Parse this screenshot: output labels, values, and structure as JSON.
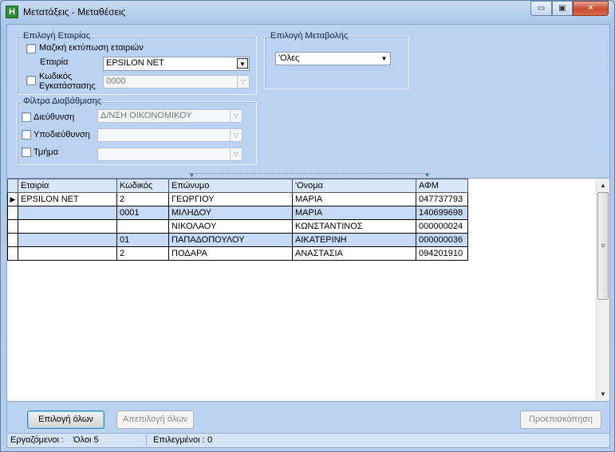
{
  "window": {
    "title": "Μετατάξεις - Μεταθέσεις",
    "app_icon_glyph": "H",
    "minimize_glyph": "▭",
    "maximize_glyph": "▣",
    "close_glyph": "✕"
  },
  "company_group": {
    "legend": "Επιλογή Εταιρίας",
    "mass_print_label": "Μαζική εκτύπωση εταιριών",
    "company_label": "Εταιρία",
    "company_value": "EPSILON NET",
    "install_code_label_1": "Κωδικός",
    "install_code_label_2": "Εγκατάστασης",
    "install_code_value": "0000"
  },
  "change_group": {
    "legend": "Επιλογή Μεταβολής",
    "value": "'Ολες"
  },
  "filter_group": {
    "legend": "Φίλτρα Διαβάθμισης",
    "direction_label": "Διεύθυνση",
    "direction_value": "Δ/ΝΣΗ ΟΙΚΟΝΟΜΙΚΟΥ",
    "subdirection_label": "Υποδιεύθυνση",
    "subdirection_value": "",
    "department_label": "Τμήμα",
    "department_value": ""
  },
  "grid": {
    "columns": [
      "Εταιρία",
      "Κωδικός",
      "Επώνυμο",
      "'Ονομα",
      "ΑΦΜ"
    ],
    "current_row_marker": "▶",
    "rows": [
      {
        "company": "EPSILON NET",
        "code": "2",
        "surname": "ΓΕΩΡΓΙΟΥ",
        "name": "ΜΑΡΙΑ",
        "afm": "047737793"
      },
      {
        "company": "",
        "code": "0001",
        "surname": "ΜΙΛΗΔΟΥ",
        "name": "ΜΑΡΙΑ",
        "afm": "140699698"
      },
      {
        "company": "",
        "code": "",
        "surname": "ΝΙΚΟΛΑΟΥ",
        "name": "ΚΩΝΣΤΑΝΤΙΝΟΣ",
        "afm": "000000024"
      },
      {
        "company": "",
        "code": "01",
        "surname": "ΠΑΠΑΔΟΠΟΥΛΟΥ",
        "name": "ΑΙΚΑΤΕΡΙΝΗ",
        "afm": "000000036"
      },
      {
        "company": "",
        "code": "2",
        "surname": "ΠΟΔΑΡΑ",
        "name": "ΑΝΑΣΤΑΣΙΑ",
        "afm": "094201910"
      }
    ]
  },
  "buttons": {
    "select_all": "Επιλογή όλων",
    "deselect_all": "Απεπιλογή όλων",
    "preview": "Προεπισκόπηση"
  },
  "status": {
    "processing_label": "Εργαζόμενοι :",
    "processing_value": "Όλοι 5",
    "selected_label": "Επιλεγμένοι :",
    "selected_value": "0"
  }
}
